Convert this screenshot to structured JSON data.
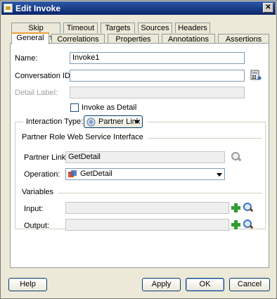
{
  "window": {
    "title": "Edit Invoke",
    "close_glyph": "✕"
  },
  "tabs_row1": [
    "Skip Condition",
    "Timeout",
    "Targets",
    "Sources",
    "Headers"
  ],
  "tabs_row2": [
    "General",
    "Correlations",
    "Properties",
    "Annotations",
    "Assertions"
  ],
  "form": {
    "name_label": "Name:",
    "name_value": "Invoke1",
    "conversation_id_label": "Conversation ID:",
    "conversation_id_value": "",
    "detail_label_label": "Detail Label:",
    "detail_label_value": "",
    "invoke_as_detail_label": "Invoke as Detail",
    "interaction_type_label": "Interaction Type:",
    "interaction_type_value": "Partner Link"
  },
  "partner_role": {
    "section_title": "Partner Role Web Service Interface",
    "partner_link_label": "Partner Link:",
    "partner_link_value": "GetDetail",
    "operation_label": "Operation:",
    "operation_value": "GetDetail"
  },
  "variables": {
    "section_title": "Variables",
    "input_label": "Input:",
    "input_value": "",
    "output_label": "Output:",
    "output_value": ""
  },
  "buttons": {
    "help": "Help",
    "apply": "Apply",
    "ok": "OK",
    "cancel": "Cancel"
  },
  "colors": {
    "title_bar": "#0a246a",
    "active_tab_accent": "#e8a13a",
    "dialog_bg": "#ece9d8"
  }
}
